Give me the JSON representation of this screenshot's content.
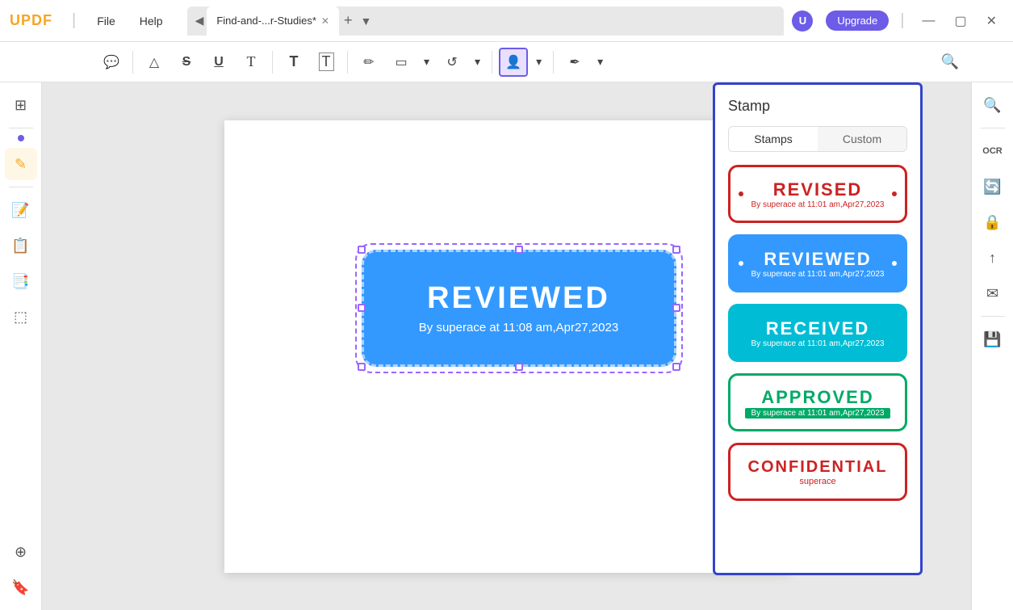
{
  "app": {
    "logo": "UPDF",
    "logo_color": "#f5a623",
    "menu_file": "File",
    "menu_help": "Help",
    "tab_title": "Find-and-...r-Studies*",
    "upgrade_label": "Upgrade",
    "upgrade_avatar": "U"
  },
  "toolbar": {
    "comment_icon": "💬",
    "highlight_icon": "◭",
    "strikethrough_icon": "S",
    "underline_icon": "U",
    "text_icon": "T",
    "text2_icon": "T",
    "text3_icon": "T",
    "eraser_icon": "✎",
    "shape_icon": "▭",
    "shape_dropdown": "▾",
    "rotate_icon": "↺",
    "stamp_icon": "👤",
    "pen_icon": "✒",
    "pen_dropdown": "▾",
    "search_icon": "🔍"
  },
  "left_sidebar": {
    "icons": [
      "📄",
      "—",
      "✎",
      "—",
      "📑",
      "📋",
      "📂"
    ]
  },
  "right_sidebar": {
    "icons": [
      "🔍",
      "—",
      "🖨",
      "📄",
      "📤",
      "✉",
      "—",
      "💾"
    ]
  },
  "pdf_stamp": {
    "title": "REVIEWED",
    "subtitle": "By superace at 11:08 am,Apr27,2023"
  },
  "stamp_panel": {
    "title": "Stamp",
    "tab_stamps": "Stamps",
    "tab_custom": "Custom",
    "active_tab": "stamps",
    "stamps": [
      {
        "id": "revised",
        "title": "REVISED",
        "subtitle": "By superace at 11:01 am,Apr27,2023",
        "style": "outlined-red"
      },
      {
        "id": "reviewed",
        "title": "REVIEWED",
        "subtitle": "By superace at 11:01 am,Apr27,2023",
        "style": "filled-blue"
      },
      {
        "id": "received",
        "title": "RECEIVED",
        "subtitle": "By superace at 11:01 am,Apr27,2023",
        "style": "filled-teal"
      },
      {
        "id": "approved",
        "title": "APPROVED",
        "subtitle": "By superace at 11:01 am,Apr27,2023",
        "style": "outlined-green"
      },
      {
        "id": "confidential",
        "title": "CONFIDENTIAL",
        "subtitle": "superace",
        "style": "outlined-red"
      }
    ]
  }
}
